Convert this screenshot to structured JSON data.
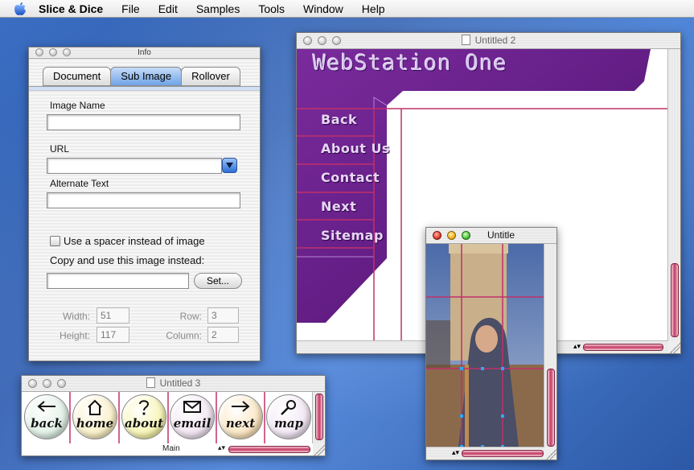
{
  "menubar": {
    "app_name": "Slice & Dice",
    "items": [
      "File",
      "Edit",
      "Samples",
      "Tools",
      "Window",
      "Help"
    ]
  },
  "info_window": {
    "title": "Info",
    "tabs": [
      "Document",
      "Sub Image",
      "Rollover"
    ],
    "active_tab": "Sub Image",
    "image_name_label": "Image Name",
    "image_name_value": "",
    "url_label": "URL",
    "url_value": "",
    "alt_text_label": "Alternate Text",
    "alt_text_value": "",
    "spacer_checkbox_label": "Use a spacer instead of image",
    "spacer_checked": false,
    "copy_label": "Copy and use this image instead:",
    "copy_value": "",
    "set_button": "Set...",
    "width_label": "Width:",
    "width_value": "51",
    "height_label": "Height:",
    "height_value": "117",
    "row_label": "Row:",
    "row_value": "3",
    "column_label": "Column:",
    "column_value": "2"
  },
  "untitled2_window": {
    "title": "Untitled 2",
    "site_title": "WebStation One",
    "nav_items": [
      "Back",
      "About Us",
      "Contact",
      "Next",
      "Sitemap"
    ],
    "colors": {
      "purple": "#6a1f8a",
      "grid_line": "#c0306a"
    }
  },
  "untitled_window": {
    "title": "Untitle"
  },
  "untitled3_window": {
    "title": "Untitled 3",
    "buttons": [
      {
        "word": "back",
        "icon": "arrow-left-icon",
        "color": "#cfe8d8"
      },
      {
        "word": "home",
        "icon": "house-icon",
        "color": "#f6e6a8"
      },
      {
        "word": "about",
        "icon": "question-icon",
        "color": "#f3ef86"
      },
      {
        "word": "email",
        "icon": "envelope-icon",
        "color": "#e9d6ea"
      },
      {
        "word": "next",
        "icon": "arrow-right-icon",
        "color": "#f8d79e"
      },
      {
        "word": "map",
        "icon": "magnifier-icon",
        "color": "#ead8ee"
      }
    ],
    "status_label": "Main"
  }
}
